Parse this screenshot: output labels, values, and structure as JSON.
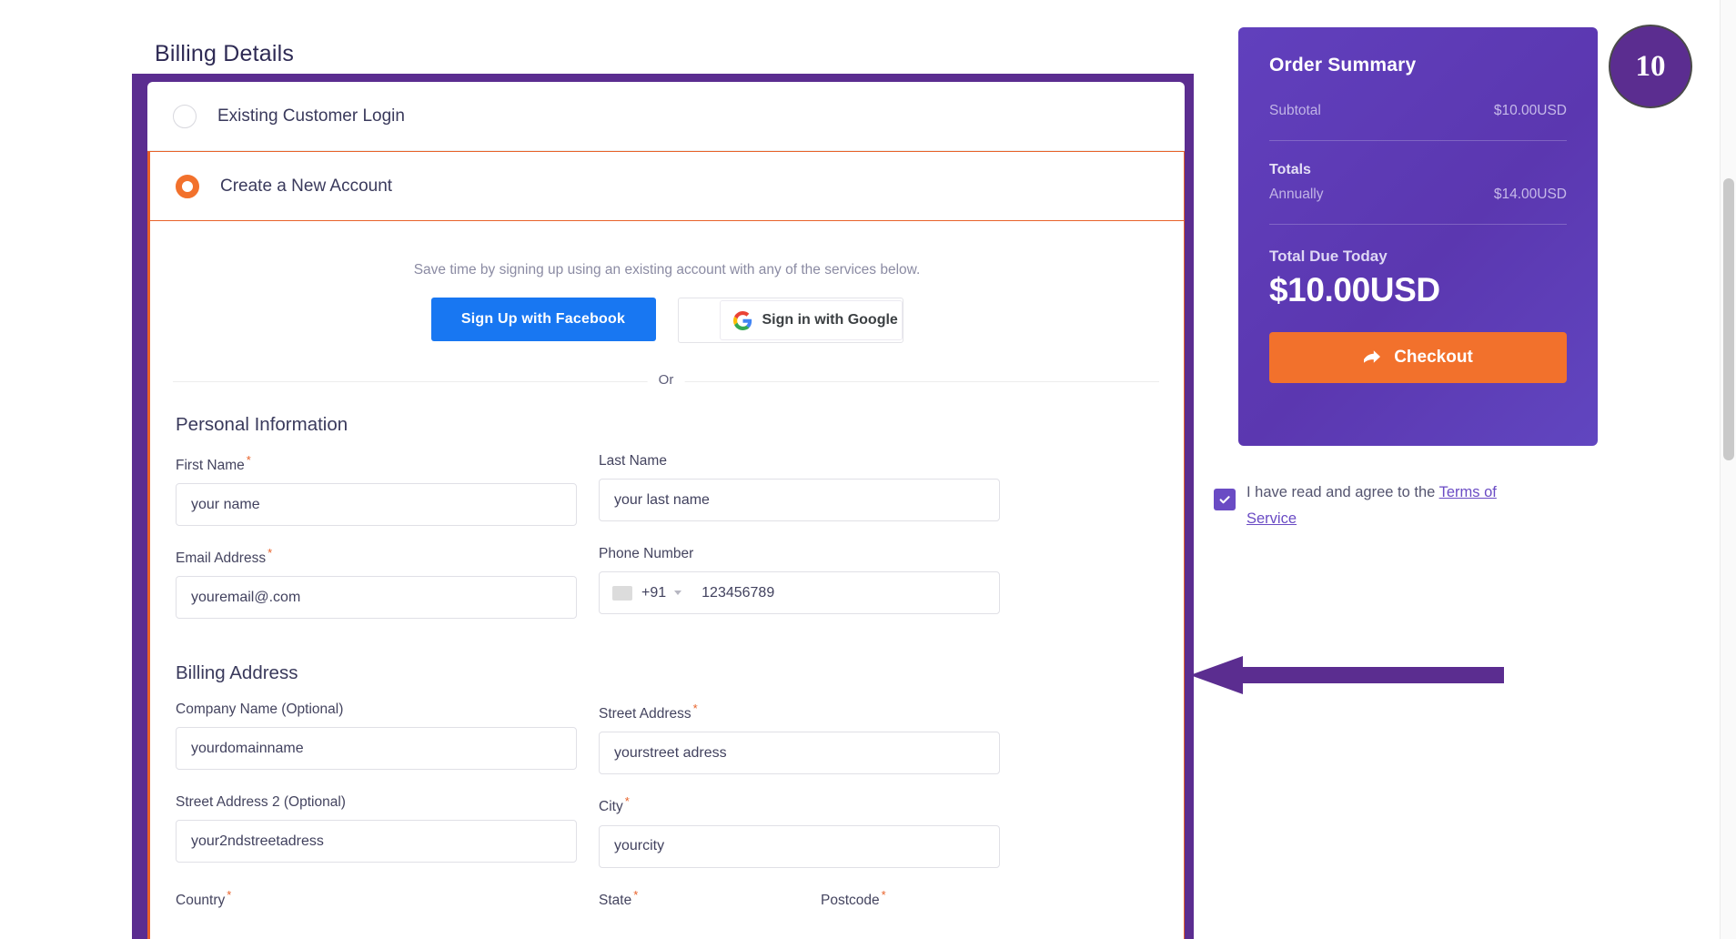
{
  "page": {
    "title": "Billing Details"
  },
  "account_options": {
    "existing": {
      "label": "Existing Customer Login",
      "selected": false
    },
    "create_new": {
      "label": "Create a New Account",
      "selected": true
    }
  },
  "social": {
    "note": "Save time by signing up using an existing account with any of the services below.",
    "facebook_label": "Sign Up with Facebook",
    "google_label": "Sign in with Google",
    "divider_label": "Or"
  },
  "personal_information": {
    "heading": "Personal Information",
    "fields": [
      {
        "label": "First Name",
        "required": true,
        "placeholder": "your name"
      },
      {
        "label": "Last Name",
        "required": false,
        "placeholder": "your last name"
      },
      {
        "label": "Email Address",
        "required": true,
        "placeholder": "youremail@.com"
      },
      {
        "label": "Phone Number",
        "required": false,
        "placeholder": "123456789",
        "dial_code": "+91"
      }
    ]
  },
  "billing_address": {
    "heading": "Billing Address",
    "fields": [
      {
        "label": "Company Name (Optional)",
        "required": false,
        "placeholder": "yourdomainname"
      },
      {
        "label": "Street Address",
        "required": true,
        "placeholder": "yourstreet adress"
      },
      {
        "label": "Street Address 2 (Optional)",
        "required": false,
        "placeholder": "your2ndstreetadress"
      },
      {
        "label": "City",
        "required": true,
        "placeholder": "yourcity"
      },
      {
        "label": "Country",
        "required": true,
        "placeholder": ""
      },
      {
        "label": "State",
        "required": true,
        "placeholder": ""
      },
      {
        "label": "Postcode",
        "required": true,
        "placeholder": ""
      }
    ]
  },
  "order_summary": {
    "title": "Order Summary",
    "subtotal_label": "Subtotal",
    "subtotal_value": "$10.00USD",
    "totals_label": "Totals",
    "annually_label": "Annually",
    "annually_value": "$14.00USD",
    "due_label": "Total Due Today",
    "due_value": "$10.00USD",
    "checkout_label": "Checkout"
  },
  "terms": {
    "checked": true,
    "text_before": "I have read and agree to the ",
    "link_text": "Terms of Service"
  },
  "annotation": {
    "step_number": "10"
  },
  "colors": {
    "brand_purple": "#5b2d90",
    "summary_purple": "#6140bd",
    "accent_orange": "#f2712c",
    "facebook_blue": "#1877f2",
    "link_purple": "#6a4bc4"
  }
}
